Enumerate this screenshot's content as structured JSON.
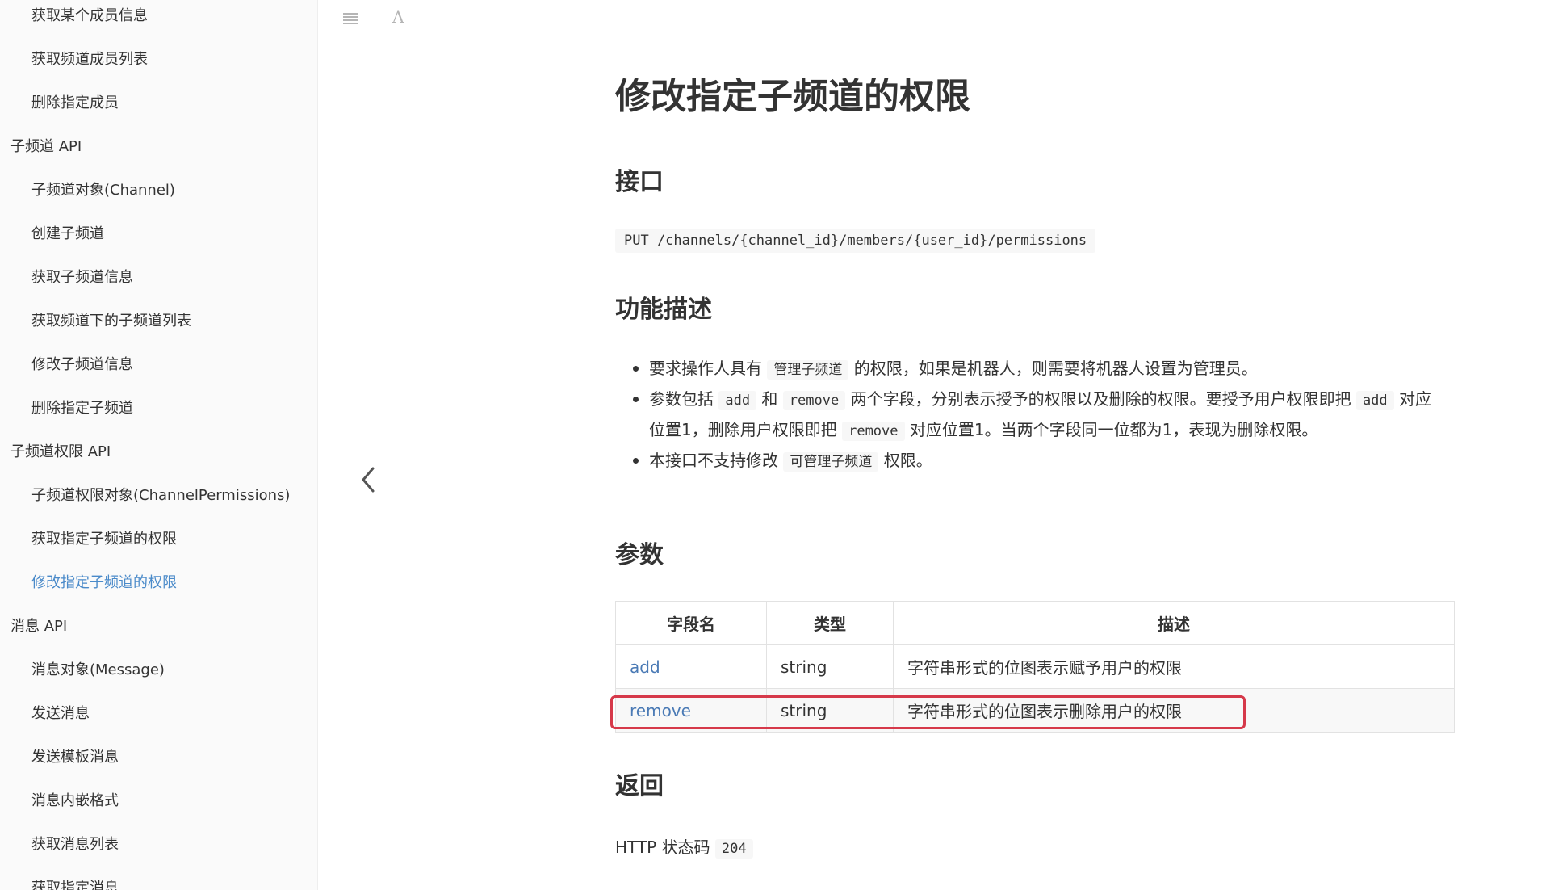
{
  "sidebar": {
    "items": [
      {
        "label": "获取某个成员信息",
        "level": "sub"
      },
      {
        "label": "获取频道成员列表",
        "level": "sub"
      },
      {
        "label": "删除指定成员",
        "level": "sub"
      },
      {
        "label": "子频道 API",
        "level": "section"
      },
      {
        "label": "子频道对象(Channel)",
        "level": "sub"
      },
      {
        "label": "创建子频道",
        "level": "sub"
      },
      {
        "label": "获取子频道信息",
        "level": "sub"
      },
      {
        "label": "获取频道下的子频道列表",
        "level": "sub"
      },
      {
        "label": "修改子频道信息",
        "level": "sub"
      },
      {
        "label": "删除指定子频道",
        "level": "sub"
      },
      {
        "label": "子频道权限 API",
        "level": "section"
      },
      {
        "label": "子频道权限对象(ChannelPermissions)",
        "level": "sub"
      },
      {
        "label": "获取指定子频道的权限",
        "level": "sub"
      },
      {
        "label": "修改指定子频道的权限",
        "level": "sub",
        "active": true
      },
      {
        "label": "消息 API",
        "level": "section"
      },
      {
        "label": "消息对象(Message)",
        "level": "sub"
      },
      {
        "label": "发送消息",
        "level": "sub"
      },
      {
        "label": "发送模板消息",
        "level": "sub"
      },
      {
        "label": "消息内嵌格式",
        "level": "sub"
      },
      {
        "label": "获取消息列表",
        "level": "sub"
      },
      {
        "label": "获取指定消息",
        "level": "sub"
      }
    ],
    "active_color": "#4a8ac9"
  },
  "toolbar": {
    "font_icon_glyph": "A"
  },
  "page": {
    "title": "修改指定子频道的权限",
    "interface_heading": "接口",
    "endpoint": "PUT /channels/{channel_id}/members/{user_id}/permissions",
    "desc_heading": "功能描述",
    "desc": {
      "item1_pre": "要求操作人具有 ",
      "item1_code": "管理子频道",
      "item1_post": " 的权限，如果是机器人，则需要将机器人设置为管理员。",
      "item2_pre": "参数包括 ",
      "item2_code1": "add",
      "item2_mid1": " 和 ",
      "item2_code2": "remove",
      "item2_mid2": " 两个字段，分别表示授予的权限以及删除的权限。要授予用户权限即把 ",
      "item2_code3": "add",
      "item2_mid3": " 对应位置1，删除用户权限即把 ",
      "item2_code4": "remove",
      "item2_post": " 对应位置1。当两个字段同一位都为1，表现为删除权限。",
      "item3_pre": "本接口不支持修改 ",
      "item3_code": "可管理子频道",
      "item3_post": " 权限。"
    },
    "params_heading": "参数",
    "params_table": {
      "headers": [
        "字段名",
        "类型",
        "描述"
      ],
      "rows": [
        {
          "field": "add",
          "type": "string",
          "desc": "字符串形式的位图表示赋予用户的权限"
        },
        {
          "field": "remove",
          "type": "string",
          "desc": "字符串形式的位图表示删除用户的权限"
        }
      ]
    },
    "return_heading": "返回",
    "return_prefix": "HTTP 状态码 ",
    "return_code": "204"
  },
  "colors": {
    "link": "#4a7ab5",
    "highlight_border": "#d6394a"
  }
}
